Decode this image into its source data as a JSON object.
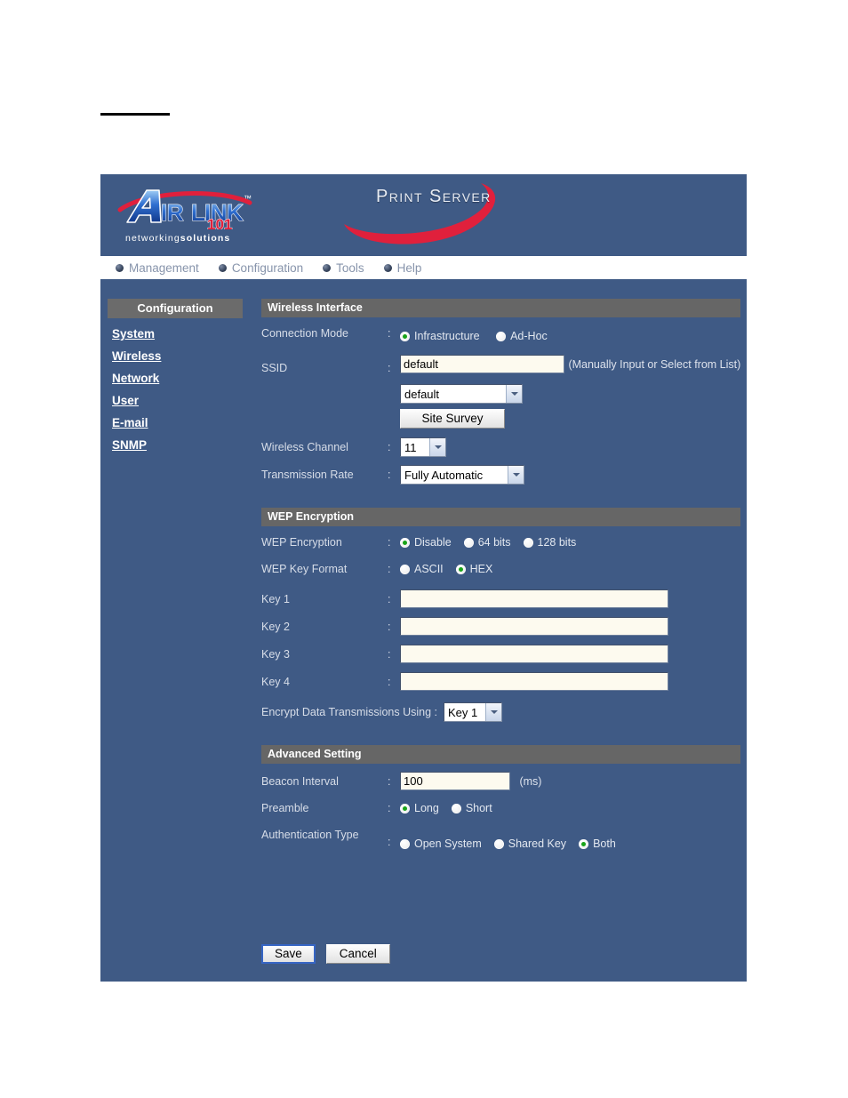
{
  "document": {
    "rule": ""
  },
  "header": {
    "logo_brand": "AirLink",
    "logo_number": "101",
    "logo_tagline_thin": "networking",
    "logo_tagline_bold": "solutions",
    "product_title": "Print Server"
  },
  "nav": {
    "items": [
      {
        "label": "Management"
      },
      {
        "label": "Configuration"
      },
      {
        "label": "Tools"
      },
      {
        "label": "Help"
      }
    ]
  },
  "sidebar": {
    "title": "Configuration",
    "items": [
      {
        "label": "System"
      },
      {
        "label": "Wireless"
      },
      {
        "label": "Network"
      },
      {
        "label": "User"
      },
      {
        "label": "E-mail"
      },
      {
        "label": "SNMP"
      }
    ]
  },
  "sections": {
    "wireless_interface": {
      "title": "Wireless Interface",
      "connection_mode": {
        "label": "Connection Mode",
        "colon": ":",
        "options": [
          {
            "label": "Infrastructure",
            "selected": true
          },
          {
            "label": "Ad-Hoc",
            "selected": false
          }
        ]
      },
      "ssid": {
        "label": "SSID",
        "colon": ":",
        "value": "default",
        "placeholder": "",
        "hint": "(Manually Input or Select from List)",
        "select_value": "default",
        "site_survey_label": "Site Survey"
      },
      "wireless_channel": {
        "label": "Wireless Channel",
        "colon": ":",
        "value": "11"
      },
      "transmission_rate": {
        "label": "Transmission Rate",
        "colon": ":",
        "value": "Fully Automatic"
      }
    },
    "wep_encryption": {
      "title": "WEP Encryption",
      "mode": {
        "label": "WEP Encryption",
        "colon": ":",
        "options": [
          {
            "label": "Disable",
            "selected": true
          },
          {
            "label": "64 bits",
            "selected": false
          },
          {
            "label": "128 bits",
            "selected": false
          }
        ]
      },
      "key_format": {
        "label": "WEP Key Format",
        "colon": ":",
        "options": [
          {
            "label": "ASCII",
            "selected": false
          },
          {
            "label": "HEX",
            "selected": true
          }
        ]
      },
      "keys": [
        {
          "label": "Key 1",
          "colon": ":",
          "value": ""
        },
        {
          "label": "Key 2",
          "colon": ":",
          "value": ""
        },
        {
          "label": "Key 3",
          "colon": ":",
          "value": ""
        },
        {
          "label": "Key 4",
          "colon": ":",
          "value": ""
        }
      ],
      "encrypt_using": {
        "label": "Encrypt Data Transmissions Using :",
        "value": "Key 1"
      }
    },
    "advanced_setting": {
      "title": "Advanced Setting",
      "beacon_interval": {
        "label": "Beacon Interval",
        "colon": ":",
        "value": "100",
        "unit": "(ms)"
      },
      "preamble": {
        "label": "Preamble",
        "colon": ":",
        "options": [
          {
            "label": "Long",
            "selected": true
          },
          {
            "label": "Short",
            "selected": false
          }
        ]
      },
      "authentication_type": {
        "label": "Authentication Type",
        "colon": ":",
        "options": [
          {
            "label": "Open System",
            "selected": false
          },
          {
            "label": "Shared Key",
            "selected": false
          },
          {
            "label": "Both",
            "selected": true
          }
        ]
      }
    }
  },
  "actions": {
    "save_label": "Save",
    "cancel_label": "Cancel"
  },
  "colors": {
    "panel_bg": "#3f5a85",
    "section_bar": "#666666",
    "accent_red": "#e0203c",
    "logo_blue": "#1b5fc4",
    "radio_selected": "#19a319",
    "input_bg": "#fdfaef",
    "focus_ring": "#3665c4"
  }
}
